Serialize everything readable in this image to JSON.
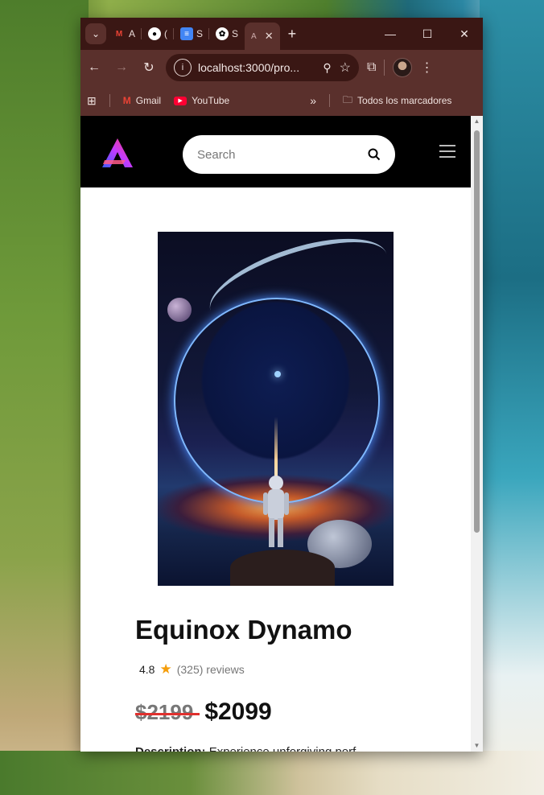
{
  "browser": {
    "tabs": [
      {
        "icon": "gmail-icon",
        "label": "A",
        "active": false
      },
      {
        "icon": "github-icon",
        "label": "(",
        "active": false
      },
      {
        "icon": "docs-icon",
        "label": "S",
        "active": false
      },
      {
        "icon": "openai-icon",
        "label": "S",
        "active": false
      },
      {
        "icon": "app-icon",
        "label": "A",
        "active": true
      }
    ],
    "url": "localhost:3000/pro...",
    "bookmarks": {
      "gmail": "Gmail",
      "youtube": "YouTube",
      "all": "Todos los marcadores"
    }
  },
  "header": {
    "search_placeholder": "Search"
  },
  "product": {
    "title": "Equinox Dynamo",
    "rating": "4.8",
    "reviews": "(325) reviews",
    "old_price": "$2199",
    "price": "$2099",
    "description_label": "Description:",
    "description_text": "Experience unforgiving perf..."
  },
  "colors": {
    "browser_frame": "#3a1714",
    "toolbar": "#5a302c",
    "header_bg": "#000000",
    "star": "#f59e0b",
    "strike": "#e0302e"
  }
}
